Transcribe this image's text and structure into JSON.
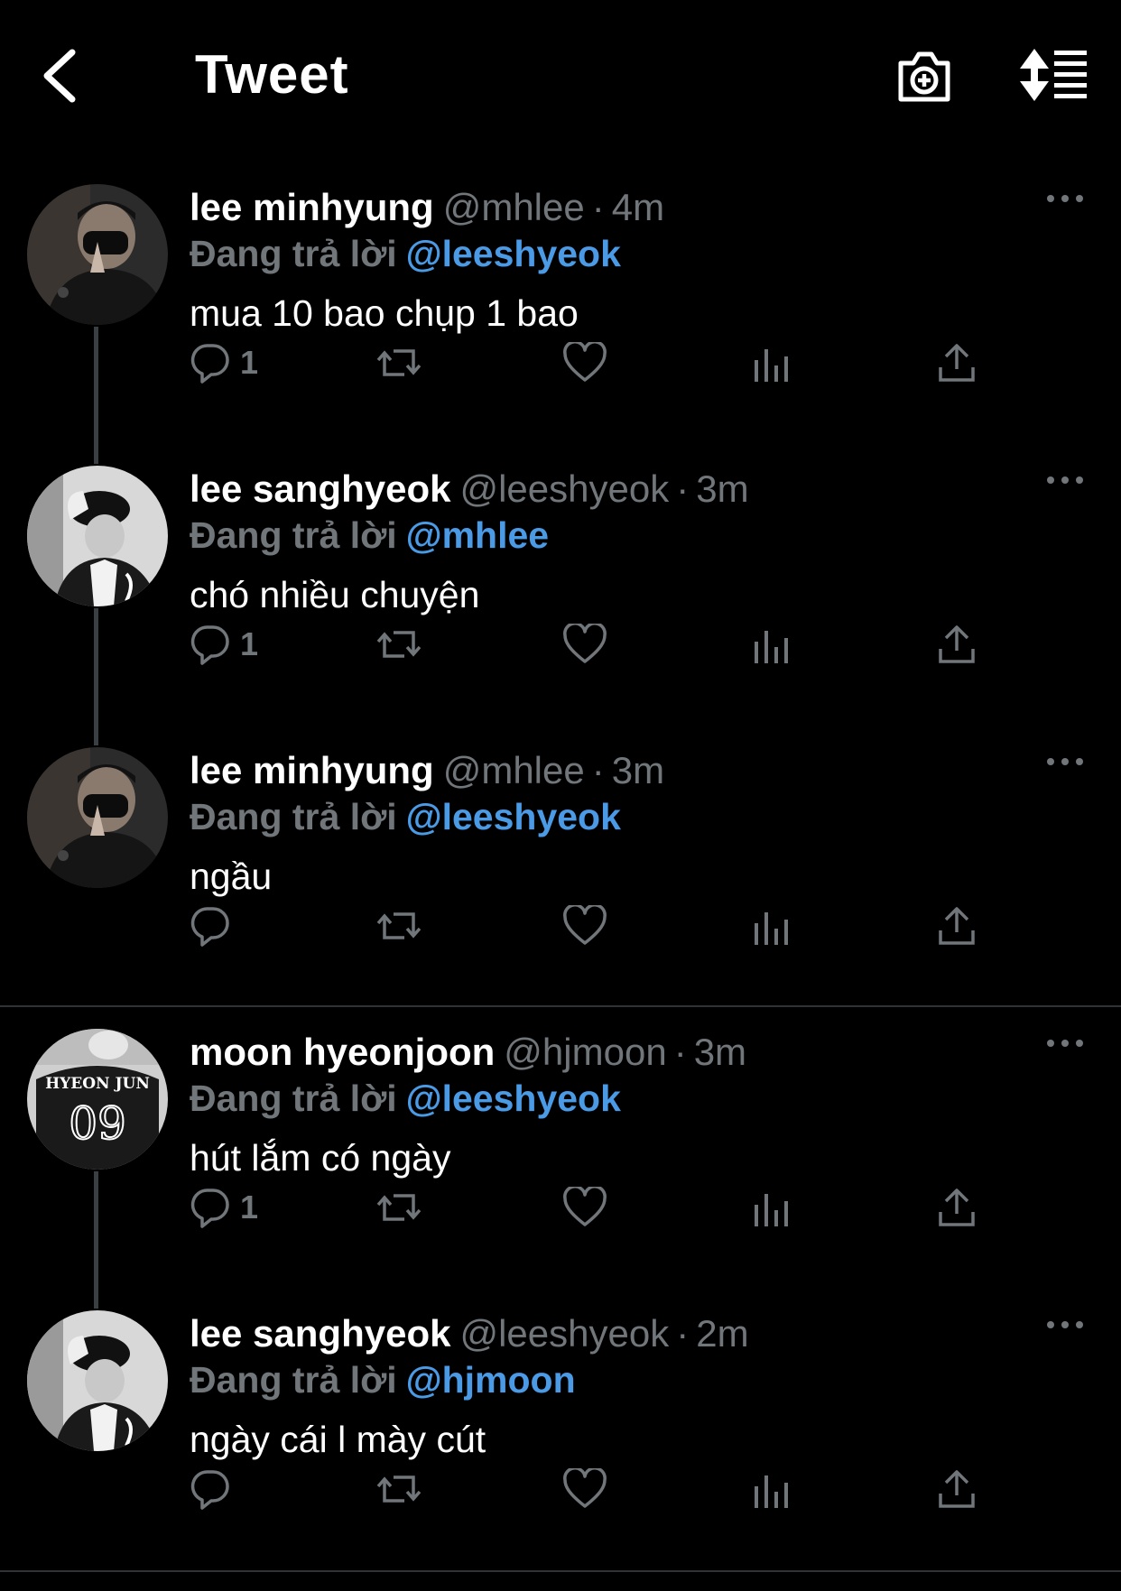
{
  "header": {
    "title": "Tweet",
    "back_icon": "chevron-left-icon",
    "camera_icon": "camera-add-icon",
    "sort_icon": "sort-replies-icon"
  },
  "colors": {
    "background": "#000000",
    "link": "#4a9ae6",
    "muted": "#71767b",
    "text": "#ffffff"
  },
  "tweets": [
    {
      "name": "lee minhyung",
      "handle": "@mhlee",
      "time": "4m",
      "replying_label": "Đang trả lời",
      "replying_to": "@leeshyeok",
      "text": "mua 10 bao chụp 1 bao",
      "reply_count": "1",
      "avatar": "masked-boy"
    },
    {
      "name": "lee sanghyeok",
      "handle": "@leeshyeok",
      "time": "3m",
      "replying_label": "Đang trả lời",
      "replying_to": "@mhlee",
      "text": "chó nhiều chuyện",
      "reply_count": "1",
      "avatar": "bw-cap"
    },
    {
      "name": "lee minhyung",
      "handle": "@mhlee",
      "time": "3m",
      "replying_label": "Đang trả lời",
      "replying_to": "@leeshyeok",
      "text": "ngầu",
      "reply_count": "",
      "avatar": "masked-boy"
    },
    {
      "name": "moon hyeonjoon",
      "handle": "@hjmoon",
      "time": "3m",
      "replying_label": "Đang trả lời",
      "replying_to": "@leeshyeok",
      "text": "hút lắm có ngày",
      "reply_count": "1",
      "avatar": "jersey",
      "jersey_name": "HYEON JUN",
      "jersey_number": "09"
    },
    {
      "name": "lee sanghyeok",
      "handle": "@leeshyeok",
      "time": "2m",
      "replying_label": "Đang trả lời",
      "replying_to": "@hjmoon",
      "text": "ngày cái l mày cút",
      "reply_count": "",
      "avatar": "bw-cap"
    }
  ]
}
